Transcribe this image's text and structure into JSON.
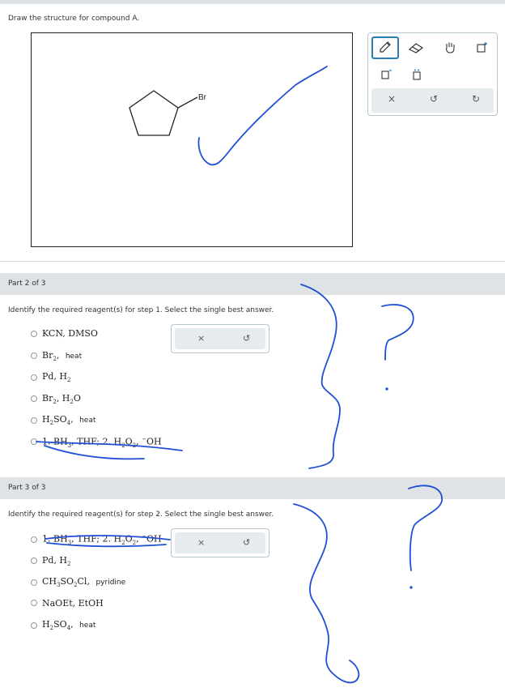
{
  "part1": {
    "prompt": "Draw the structure for compound A.",
    "molecule_label": "Br",
    "tools": {
      "pencil": "pencil-icon",
      "eraser": "eraser-icon",
      "hand": "hand-icon",
      "add": "add-icon",
      "charge_minus": "charge-minus-icon",
      "lone_pair": "lone-pair-icon",
      "clear": "×",
      "undo": "↺",
      "redo": "↻"
    }
  },
  "part2": {
    "header": "Part 2 of 3",
    "prompt": "Identify the required reagent(s) for step 1. Select the single best answer.",
    "options": [
      {
        "parts": [
          "KCN, DMSO"
        ]
      },
      {
        "parts": [
          "Br",
          "2",
          ", ",
          "heat"
        ]
      },
      {
        "parts": [
          "Pd, H",
          "2"
        ]
      },
      {
        "parts": [
          "Br",
          "2",
          ", H",
          "2",
          "O"
        ]
      },
      {
        "parts": [
          "H",
          "2",
          "SO",
          "4",
          ", ",
          "heat"
        ]
      },
      {
        "parts": [
          "1. BH",
          "3",
          ", THF; 2. H",
          "2",
          "O",
          "2",
          ", ",
          "−",
          "OH"
        ]
      }
    ],
    "clear": "×",
    "undo": "↺"
  },
  "part3": {
    "header": "Part 3 of 3",
    "prompt": "Identify the required reagent(s) for step 2. Select the single best answer.",
    "options": [
      {
        "parts": [
          "1. BH",
          "3",
          ", THF; 2. H",
          "2",
          "O",
          "2",
          ", ",
          "−",
          "OH"
        ]
      },
      {
        "parts": [
          "Pd, H",
          "2"
        ]
      },
      {
        "parts": [
          "CH",
          "3",
          "SO",
          "2",
          "Cl, ",
          "pyridine"
        ]
      },
      {
        "parts": [
          "NaOEt, EtOH"
        ]
      },
      {
        "parts": [
          "H",
          "2",
          "SO",
          "4",
          ", ",
          "heat"
        ]
      }
    ],
    "clear": "×",
    "undo": "↺"
  },
  "colors": {
    "accent": "#2a7fb5",
    "ink": "#1f4fd6",
    "bar": "#dfe3e6"
  }
}
